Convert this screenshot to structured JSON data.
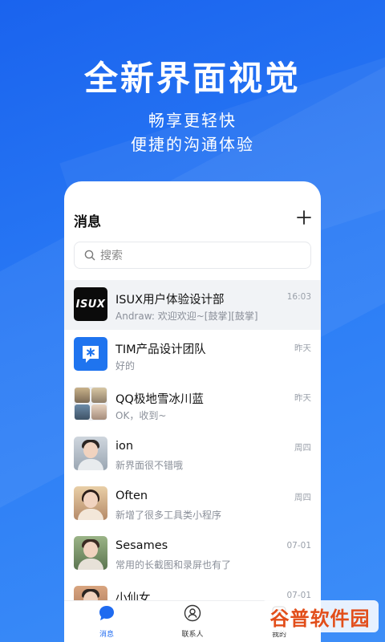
{
  "promo": {
    "headline": "全新界面视觉",
    "subline1": "畅享更轻快",
    "subline2": "便捷的沟通体验"
  },
  "app": {
    "title": "消息",
    "add_icon": "plus-icon",
    "search_placeholder": "搜索"
  },
  "conversations": [
    {
      "name": "ISUX用户体验设计部",
      "preview": "Andraw: 欢迎欢迎~[鼓掌][鼓掌]",
      "time": "16:03",
      "avatar_text": "ISUX"
    },
    {
      "name": "TIM产品设计团队",
      "preview": "好的",
      "time": "昨天"
    },
    {
      "name": "QQ极地雪冰川蓝",
      "preview": "OK，收到~",
      "time": "昨天"
    },
    {
      "name": "ion",
      "preview": "新界面很不错哦",
      "time": "周四"
    },
    {
      "name": "Often",
      "preview": "新增了很多工具类小程序",
      "time": "周四"
    },
    {
      "name": "Sesames",
      "preview": "常用的长截图和录屏也有了",
      "time": "07-01"
    },
    {
      "name": "小仙女",
      "preview": "",
      "time": "07-01"
    }
  ],
  "tabs": [
    {
      "label": "消息",
      "icon": "chat-bubble-icon",
      "active": true
    },
    {
      "label": "联系人",
      "icon": "contacts-icon",
      "active": false
    },
    {
      "label": "我的",
      "icon": "profile-icon",
      "active": false
    }
  ],
  "watermark": {
    "text": "谷普软件园"
  },
  "colors": {
    "brand": "#1f6bf0",
    "background": "#2a7bf5",
    "muted": "#8a8f99"
  }
}
